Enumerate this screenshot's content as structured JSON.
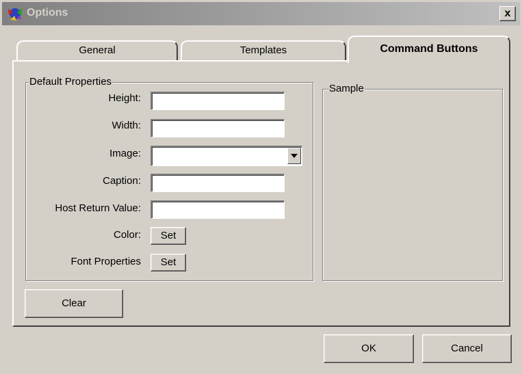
{
  "window": {
    "title": "Options",
    "close_label": "x"
  },
  "tabs": [
    {
      "label": "General",
      "active": false
    },
    {
      "label": "Templates",
      "active": false
    },
    {
      "label": "Command Buttons",
      "active": true
    }
  ],
  "default_properties": {
    "legend": "Default Properties",
    "height_label": "Height:",
    "height_value": "",
    "width_label": "Width:",
    "width_value": "",
    "image_label": "Image:",
    "image_value": "",
    "caption_label": "Caption:",
    "caption_value": "",
    "host_return_label": "Host Return Value:",
    "host_return_value": "",
    "color_label": "Color:",
    "color_button": "Set",
    "font_label": "Font Properties",
    "font_button": "Set"
  },
  "sample": {
    "legend": "Sample"
  },
  "clear_button": "Clear",
  "ok_button": "OK",
  "cancel_button": "Cancel",
  "colors": {
    "face": "#d4d0c8",
    "shadow": "#808080",
    "highlight": "#ffffff",
    "titlebar_start": "#808080",
    "titlebar_end": "#c0c0c0"
  }
}
